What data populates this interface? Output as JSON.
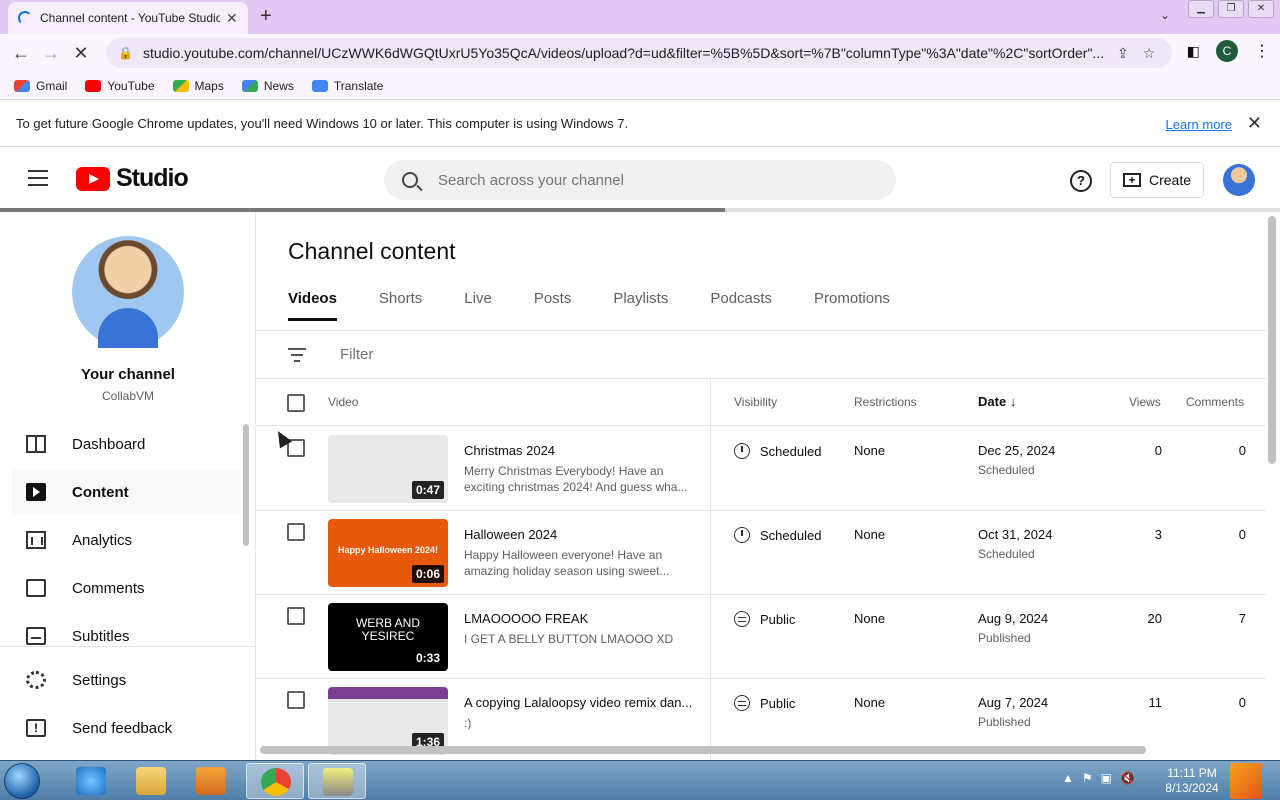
{
  "browser": {
    "tab_title": "Channel content - YouTube Studio",
    "url": "studio.youtube.com/channel/UCzWWK6dWGQtUxrU5Yo35QcA/videos/upload?d=ud&filter=%5B%5D&sort=%7B\"columnType\"%3A\"date\"%2C\"sortOrder\"...",
    "profile_initial": "C",
    "bookmarks": [
      "Gmail",
      "YouTube",
      "Maps",
      "News",
      "Translate"
    ],
    "infobar_text": "To get future Google Chrome updates, you'll need Windows 10 or later. This computer is using Windows 7.",
    "infobar_link": "Learn more"
  },
  "header": {
    "logo_text": "Studio",
    "search_placeholder": "Search across your channel",
    "create_label": "Create"
  },
  "sidebar": {
    "channel_name": "Your channel",
    "channel_handle": "CollabVM",
    "items": [
      {
        "label": "Dashboard"
      },
      {
        "label": "Content"
      },
      {
        "label": "Analytics"
      },
      {
        "label": "Comments"
      },
      {
        "label": "Subtitles"
      },
      {
        "label": "Settings"
      },
      {
        "label": "Send feedback"
      }
    ]
  },
  "main": {
    "title": "Channel content",
    "tabs": [
      "Videos",
      "Shorts",
      "Live",
      "Posts",
      "Playlists",
      "Podcasts",
      "Promotions"
    ],
    "filter_placeholder": "Filter",
    "columns": {
      "video": "Video",
      "visibility": "Visibility",
      "restrictions": "Restrictions",
      "date": "Date",
      "views": "Views",
      "comments": "Comments"
    },
    "videos": [
      {
        "title": "Christmas 2024",
        "description": "Merry Christmas Everybody! Have an exciting christmas 2024! And guess wha...",
        "duration": "0:47",
        "visibility": "Scheduled",
        "restrictions": "None",
        "date": "Dec 25, 2024",
        "date_status": "Scheduled",
        "views": "0",
        "comments": "0",
        "thumb_text": ""
      },
      {
        "title": "Halloween 2024",
        "description": "Happy Halloween everyone! Have an amazing holiday season using sweet...",
        "duration": "0:06",
        "visibility": "Scheduled",
        "restrictions": "None",
        "date": "Oct 31, 2024",
        "date_status": "Scheduled",
        "views": "3",
        "comments": "0",
        "thumb_text": "Happy Halloween 2024!"
      },
      {
        "title": "LMAOOOOO FREAK",
        "description": "I GET A BELLY BUTTON LMAOOO XD",
        "duration": "0:33",
        "visibility": "Public",
        "restrictions": "None",
        "date": "Aug 9, 2024",
        "date_status": "Published",
        "views": "20",
        "comments": "7",
        "thumb_text": "WERB AND YESIREC"
      },
      {
        "title": "A copying Lalaloopsy video remix dan...",
        "description": ":)",
        "duration": "1:36",
        "visibility": "Public",
        "restrictions": "None",
        "date": "Aug 7, 2024",
        "date_status": "Published",
        "views": "11",
        "comments": "0",
        "thumb_text": ""
      }
    ]
  },
  "taskbar": {
    "time": "11:11 PM",
    "date": "8/13/2024"
  },
  "colors": {
    "yt_red": "#ff0000",
    "halloween_orange": "#e8590c",
    "link_blue": "#1a73e8"
  }
}
